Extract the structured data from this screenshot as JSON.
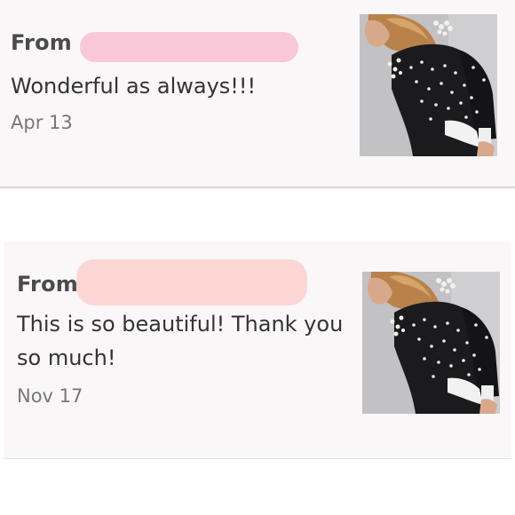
{
  "reviews": [
    {
      "from_label": "From",
      "text": "Wonderful as always!!!",
      "date": "Apr 13",
      "redaction_color": "#f8c8d8",
      "thumbnail": "listing-photo-black-pearl-sweater"
    },
    {
      "from_label": "From",
      "text": "This is so beautiful! Thank you so much!",
      "date": "Nov 17",
      "redaction_color": "#fcd6d3",
      "thumbnail": "listing-photo-black-pearl-sweater"
    }
  ],
  "colors": {
    "card_background": "#faf7f8",
    "sweater": "#1b1b1d",
    "pearls": "#f4f1ea",
    "hair": "#b8824a",
    "photo_background": "#c4c4c6"
  }
}
